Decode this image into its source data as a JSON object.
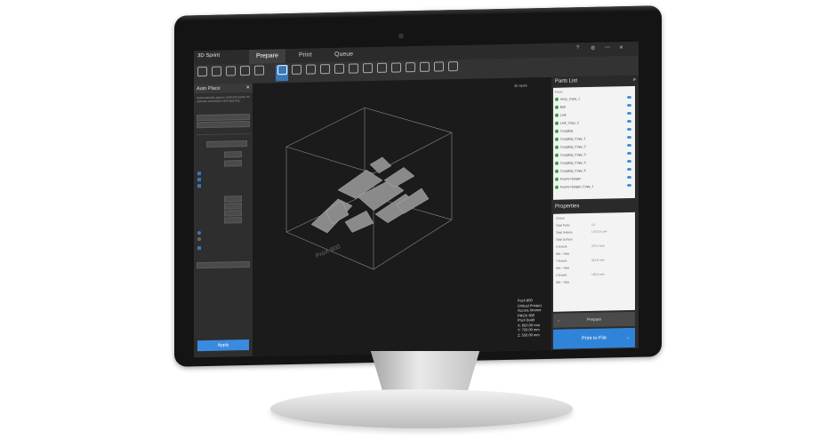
{
  "app": {
    "logo": "3D Sprint",
    "tabs": [
      {
        "label": "Prepare"
      },
      {
        "label": "Print"
      },
      {
        "label": "Queue"
      }
    ],
    "window_controls": [
      "help-icon",
      "settings-icon",
      "minimize-icon",
      "close-icon"
    ]
  },
  "left_panel": {
    "title": "Auto Place",
    "description": "Automatically places selected parts on optimal orientation and spacing",
    "apply_label": "Apply"
  },
  "viewport": {
    "info": "3D Sprint",
    "stats": [
      "ProX 800",
      "(Virtual Printer)",
      "Accura Xtreme",
      "PROX 800",
      "ProX Build",
      "X: 650.00 mm",
      "Y: 750.00 mm",
      "Z: 550.00 mm"
    ],
    "build_label": "ProX 800",
    "colors": {
      "background": "#1b1b1b",
      "parts": "#8a8a8a",
      "box": "#8c8c8c"
    }
  },
  "right_panel": {
    "parts_title": "Parts List",
    "parts_root": "Parts",
    "parts": [
      "Assy_Copy_1",
      "Ball",
      "Link",
      "Link_Copy_2",
      "Coupling",
      "Coupling_Copy_1",
      "Coupling_Copy_2",
      "Coupling_Copy_3",
      "Coupling_Copy_4",
      "Coupling_Copy_5",
      "Frame Hanger",
      "Frame Hanger_Copy_1"
    ],
    "properties_title": "Properties",
    "properties_group": "Global",
    "properties": [
      {
        "key": "Total Parts",
        "value": "13"
      },
      {
        "key": "Total Volume",
        "value": "1,672.6 cm³"
      },
      {
        "key": "Total Surface",
        "value": ""
      },
      {
        "key": "X Extent",
        "value": "475.2 mm"
      },
      {
        "key": "Min – Max",
        "value": ""
      },
      {
        "key": "Y Extent",
        "value": "412.9 mm"
      },
      {
        "key": "Min – Max",
        "value": ""
      },
      {
        "key": "Z Extent",
        "value": "135.4 mm"
      },
      {
        "key": "Min – Max",
        "value": ""
      }
    ],
    "prepare_label": "Prepare",
    "print_label": "Print to File"
  }
}
